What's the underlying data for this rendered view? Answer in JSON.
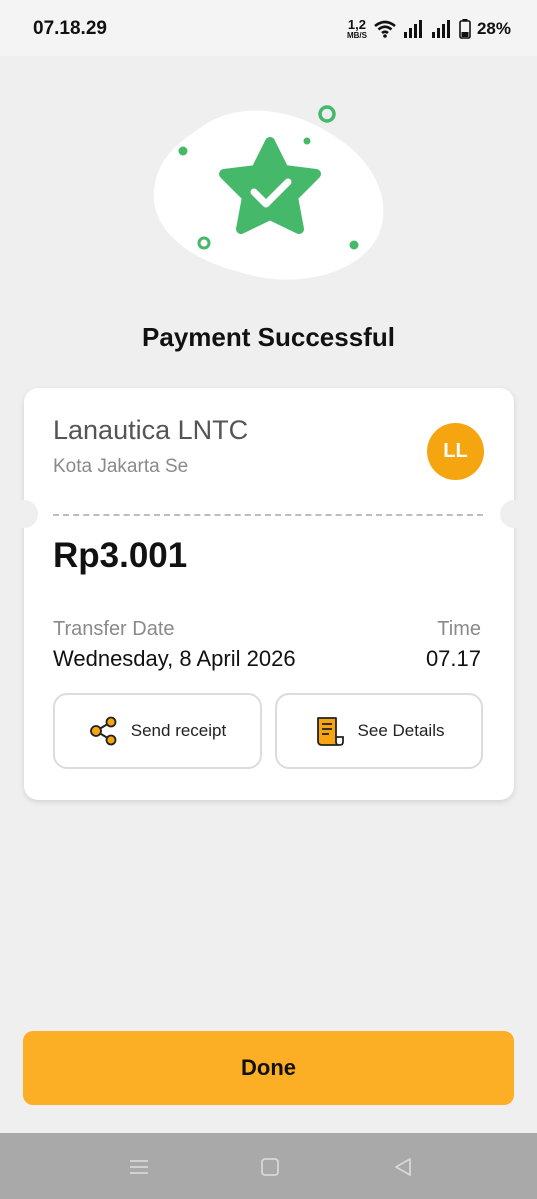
{
  "status_bar": {
    "time": "07.18.29",
    "net_speed_value": "1,2",
    "net_speed_unit": "MB/S",
    "battery_percent": "28%"
  },
  "page": {
    "title": "Payment Successful"
  },
  "receipt": {
    "merchant_name": "Lanautica LNTC",
    "merchant_location": "Kota Jakarta Se",
    "avatar_initials": "LL",
    "amount": "Rp3.001",
    "transfer_date_label": "Transfer Date",
    "transfer_date_value": "Wednesday, 8 April 2026",
    "time_label": "Time",
    "time_value": "07.17",
    "send_receipt_label": "Send receipt",
    "see_details_label": "See Details"
  },
  "footer": {
    "done_label": "Done"
  },
  "colors": {
    "accent": "#fcaf25",
    "success_green": "#46b86a",
    "avatar": "#f5a50f"
  }
}
